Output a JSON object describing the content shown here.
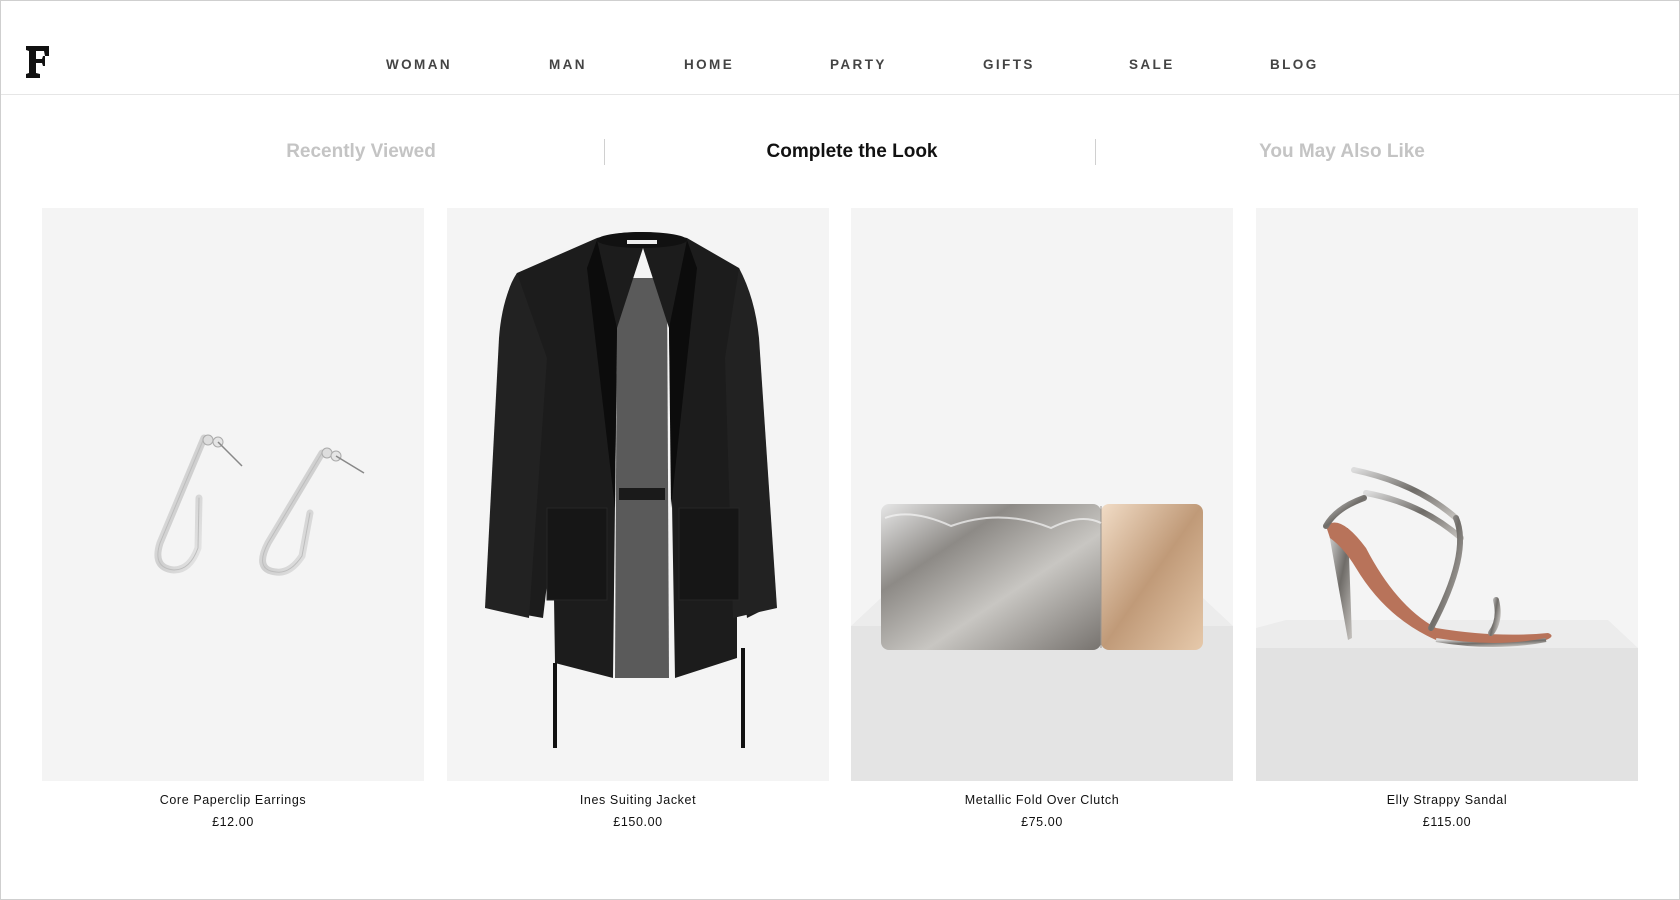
{
  "brand": {
    "logo_letter": "F"
  },
  "nav": {
    "items": [
      {
        "label": "WOMAN"
      },
      {
        "label": "MAN"
      },
      {
        "label": "HOME"
      },
      {
        "label": "PARTY"
      },
      {
        "label": "GIFTS"
      },
      {
        "label": "SALE"
      },
      {
        "label": "BLOG"
      }
    ]
  },
  "tabs": [
    {
      "label": "Recently Viewed",
      "active": false
    },
    {
      "label": "Complete the Look",
      "active": true
    },
    {
      "label": "You May Also Like",
      "active": false
    }
  ],
  "products": [
    {
      "name": "Core Paperclip Earrings",
      "price": "£12.00",
      "image": "earrings-image"
    },
    {
      "name": "Ines Suiting Jacket",
      "price": "£150.00",
      "image": "jacket-image"
    },
    {
      "name": "Metallic Fold Over Clutch",
      "price": "£75.00",
      "image": "clutch-image"
    },
    {
      "name": "Elly Strappy Sandal",
      "price": "£115.00",
      "image": "sandal-image"
    }
  ],
  "colors": {
    "tab_active": "#111111",
    "tab_inactive": "#c4c4c4",
    "nav_text": "#444444",
    "product_bg": "#f4f4f4"
  }
}
